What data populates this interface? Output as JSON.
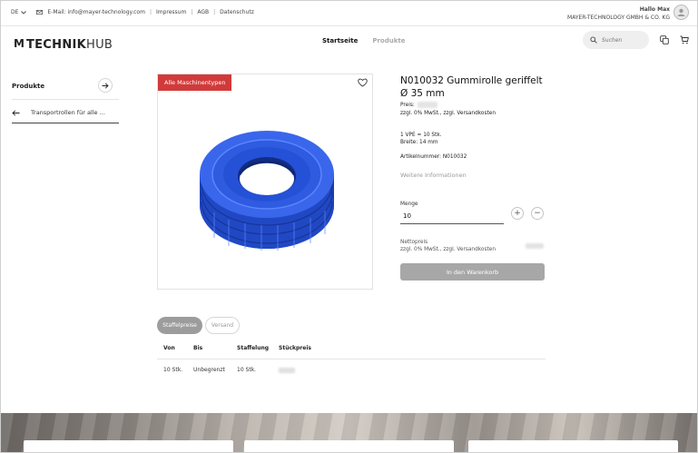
{
  "topbar": {
    "language": "DE",
    "email": "E-Mail: info@mayer-technology.com",
    "links": [
      "Impressum",
      "AGB",
      "Datenschutz"
    ],
    "greeting": "Hallo Max",
    "company": "MAYER-TECHNOLOGY GMBH & CO. KG"
  },
  "header": {
    "logo_mark": "M",
    "logo_word1": "TECHNIK",
    "logo_word2": "HUB",
    "nav": [
      "Startseite",
      "Produkte"
    ],
    "search_placeholder": "Suchen"
  },
  "sidebar": {
    "title": "Produkte",
    "item": "Transportrollen für alle ..."
  },
  "product": {
    "badge": "Alle Maschinentypen",
    "title": "N010032 Gummirolle geriffelt Ø 35 mm",
    "price_label": "Preis:",
    "tax_note": "zzgl. 0% MwSt., zzgl. Versandkosten",
    "vpe": "1 VPE = 10 Stk.",
    "width": "Breite: 14 mm",
    "article": "Artikelnummer: N010032",
    "more_info": "Weitere Informationen",
    "quantity_label": "Menge",
    "quantity_value": "10",
    "net_label": "Nettopreis",
    "net_tax_note": "zzgl. 0% MwSt., zzgl. Versandkosten",
    "cart_button": "In den Warenkorb",
    "wheel_color": "#2f5fe0"
  },
  "tabs": [
    "Staffelpreise",
    "Versand"
  ],
  "table": {
    "headers": [
      "Von",
      "Bis",
      "Staffelung",
      "Stückpreis"
    ],
    "rows": [
      [
        "10 Stk.",
        "Unbegrenzt",
        "10 Stk."
      ]
    ]
  }
}
